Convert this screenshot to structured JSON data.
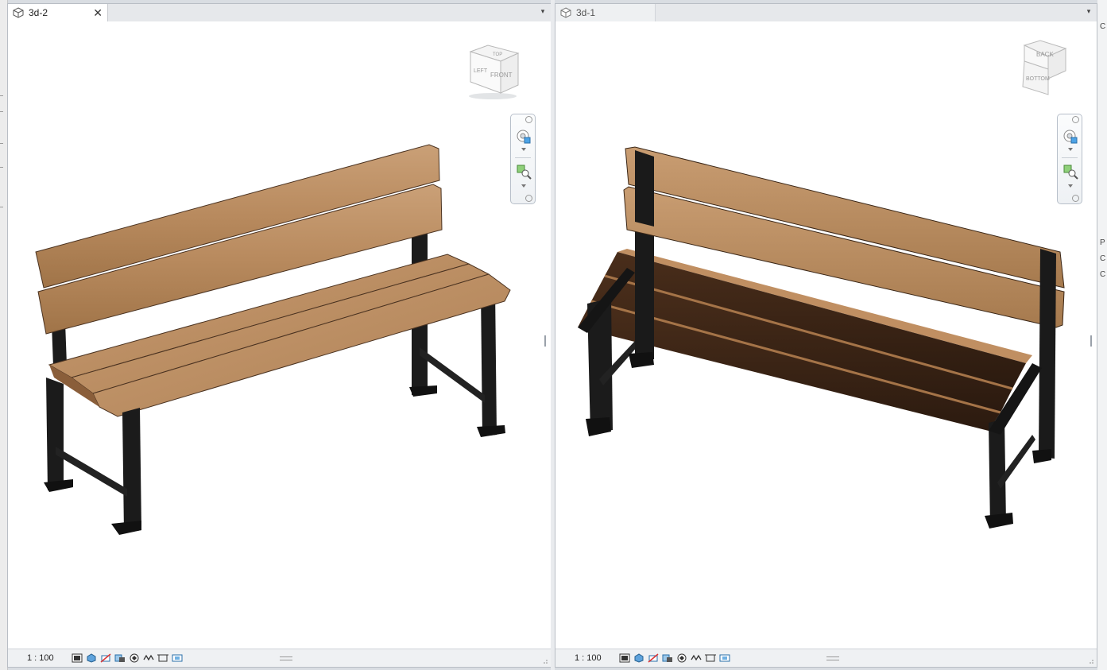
{
  "views": [
    {
      "tab_label": "3d-2",
      "close_label": "✕",
      "dropdown_label": "▾",
      "scale": "1 : 100",
      "viewcube_faces": [
        "TOP",
        "LEFT",
        "FRONT"
      ]
    },
    {
      "tab_label": "3d-1",
      "dropdown_label": "▾",
      "scale": "1 : 100",
      "viewcube_faces": [
        "BACK",
        "BOTTOM"
      ]
    }
  ],
  "colors": {
    "wood": "#b78a5f",
    "wood_dark": "#5a3b26",
    "frame": "#1a1a1a",
    "tab_active": "#ffffff",
    "statusbar": "#eff1f3"
  },
  "statusbar_icons": [
    "detail-level-icon",
    "visual-style-icon",
    "sun-path-icon",
    "shadows-icon",
    "render-icon",
    "crop-view-icon",
    "show-crop-icon",
    "temporary-hide-icon"
  ],
  "right_edge_letters": [
    "C",
    "P",
    "C",
    "C"
  ]
}
